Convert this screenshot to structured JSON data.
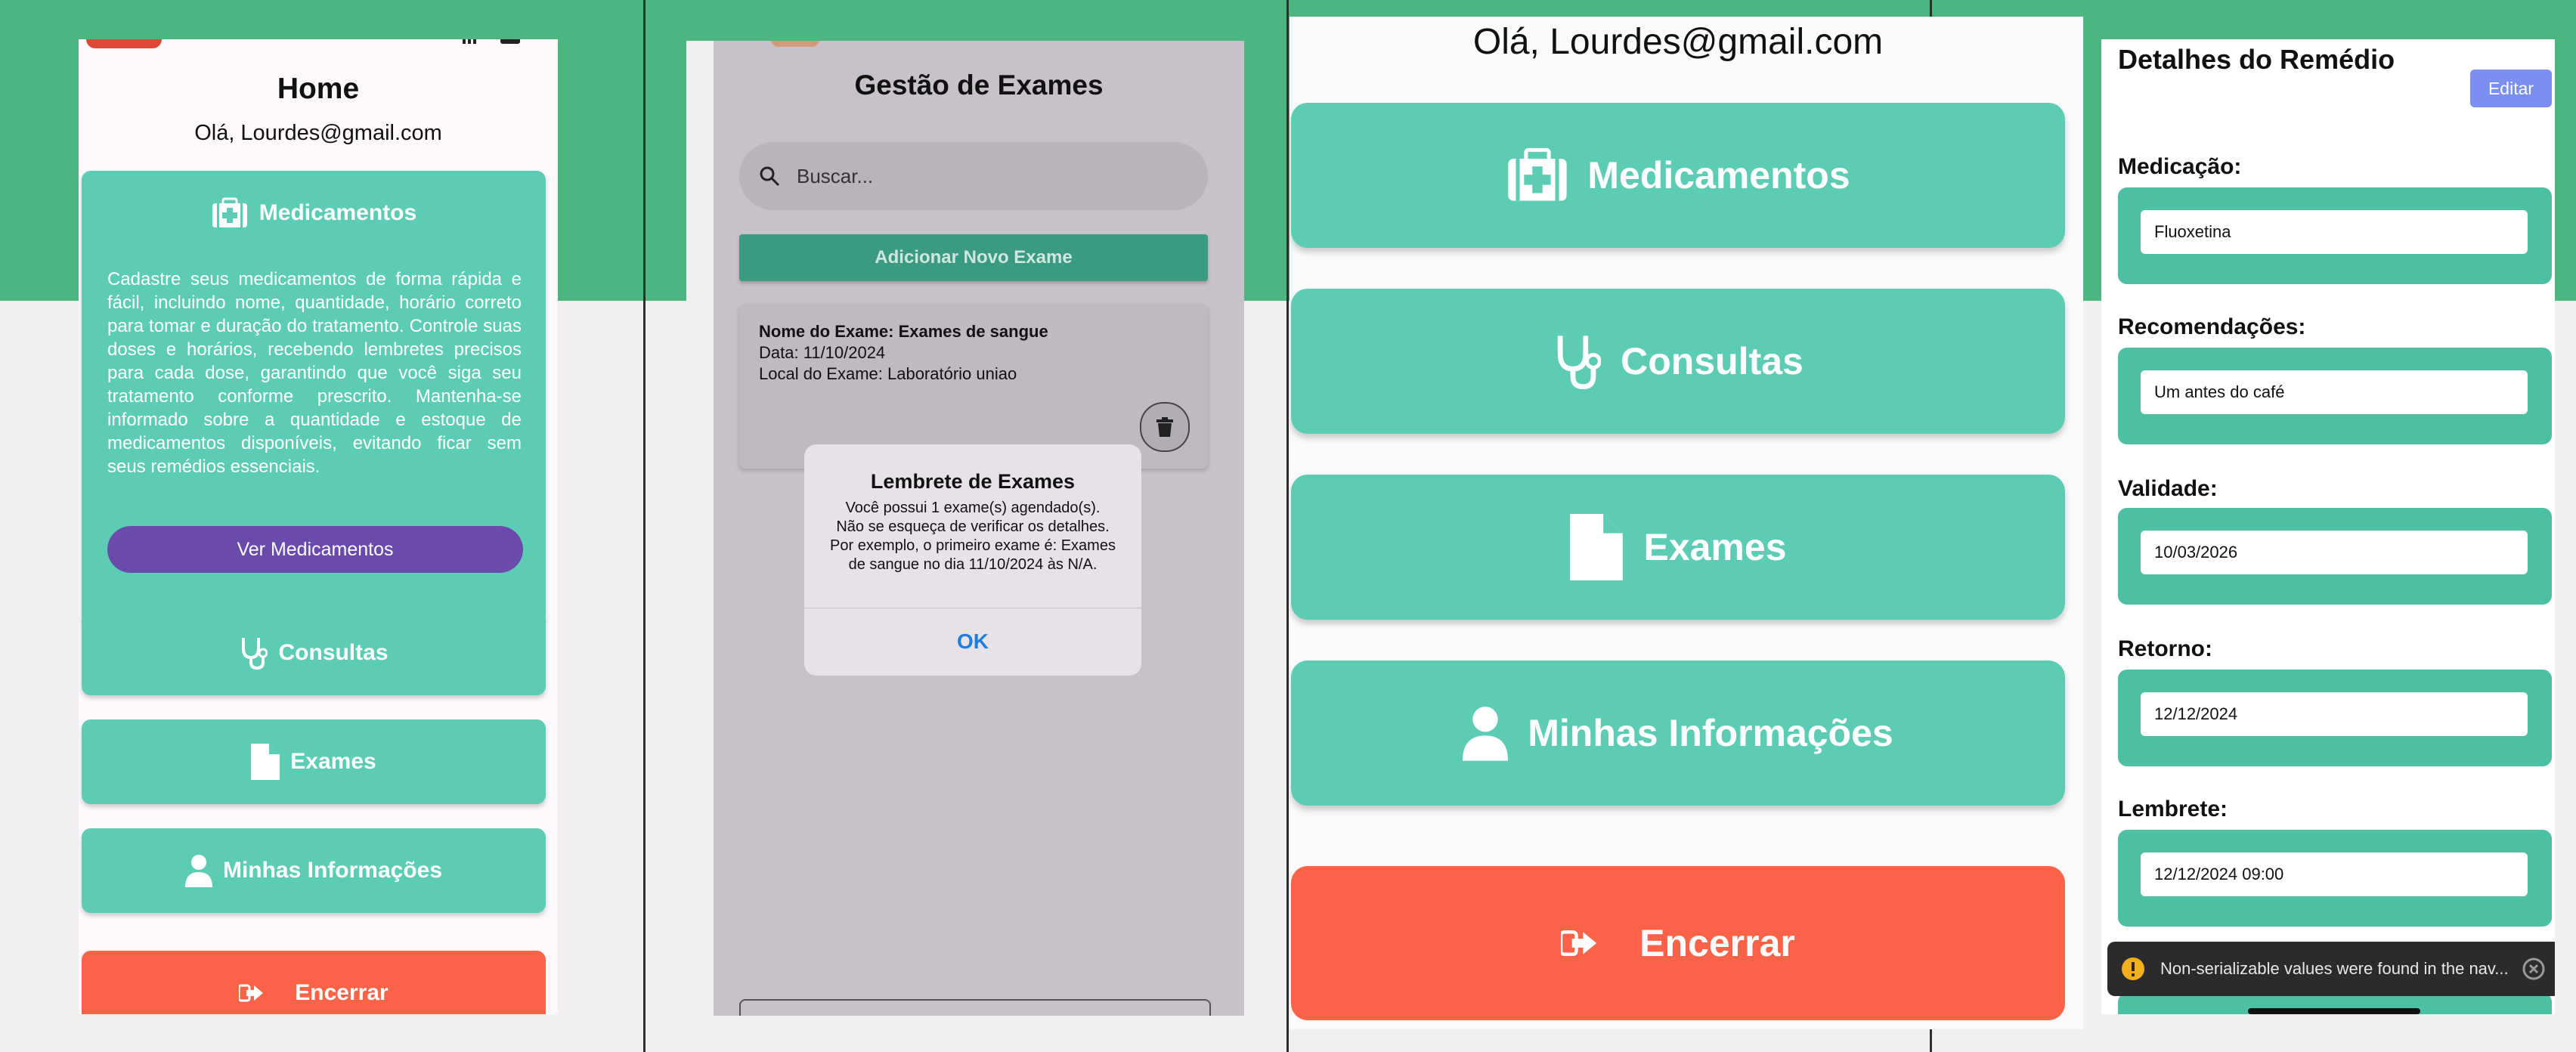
{
  "home_panel": {
    "title": "Home",
    "greeting": "Olá, Lourdes@gmail.com",
    "medicamentos": {
      "title": "Medicamentos",
      "description": "Cadastre seus medicamentos de forma rápida e fácil, incluindo nome, quantidade, horário correto para tomar e duração do tratamento. Controle suas doses e horários, recebendo lembretes precisos para cada dose, garantindo que você siga seu tratamento conforme prescrito. Mantenha-se informado sobre a quantidade e estoque de medicamentos disponíveis, evitando ficar sem seus remédios essenciais.",
      "button": "Ver Medicamentos"
    },
    "menu": [
      {
        "label": "Consultas",
        "icon": "stethoscope-icon"
      },
      {
        "label": "Exames",
        "icon": "document-icon"
      },
      {
        "label": "Minhas Informações",
        "icon": "user-icon"
      }
    ],
    "logout": "Encerrar"
  },
  "exams_panel": {
    "title": "Gestão de Exames",
    "search_placeholder": "Buscar...",
    "add_button": "Adicionar Novo Exame",
    "exam": {
      "name": "Nome do Exame: Exames de sangue",
      "date": "Data: 11/10/2024",
      "location": "Local do Exame: Laboratório uniao"
    },
    "alert": {
      "title": "Lembrete de Exames",
      "message": "Você possui 1 exame(s) agendado(s). Não se esqueça de verificar os detalhes. Por exemplo, o primeiro exame é: Exames de sangue  no dia 11/10/2024 às N/A.",
      "ok": "OK"
    }
  },
  "menu_panel": {
    "greeting": "Olá, Lourdes@gmail.com",
    "buttons": [
      "Medicamentos",
      "Consultas",
      "Exames",
      "Minhas Informações"
    ],
    "logout": "Encerrar"
  },
  "detail_panel": {
    "title": "Detalhes do Remédio",
    "edit_button": "Editar",
    "fields": [
      {
        "label": "Medicação:",
        "value": "Fluoxetina"
      },
      {
        "label": "Recomendações:",
        "value": "Um antes do café"
      },
      {
        "label": "Validade:",
        "value": "10/03/2026"
      },
      {
        "label": "Retorno:",
        "value": "12/12/2024"
      },
      {
        "label": "Lembrete:",
        "value": "12/12/2024 09:00"
      }
    ],
    "toast": "Non-serializable values were found in the nav..."
  },
  "colors": {
    "teal": "#5ccdb4",
    "purple": "#6a4bab",
    "logout_red": "#fb6348",
    "green_bg": "#4db580",
    "edit_blue": "#7b8ef2"
  }
}
